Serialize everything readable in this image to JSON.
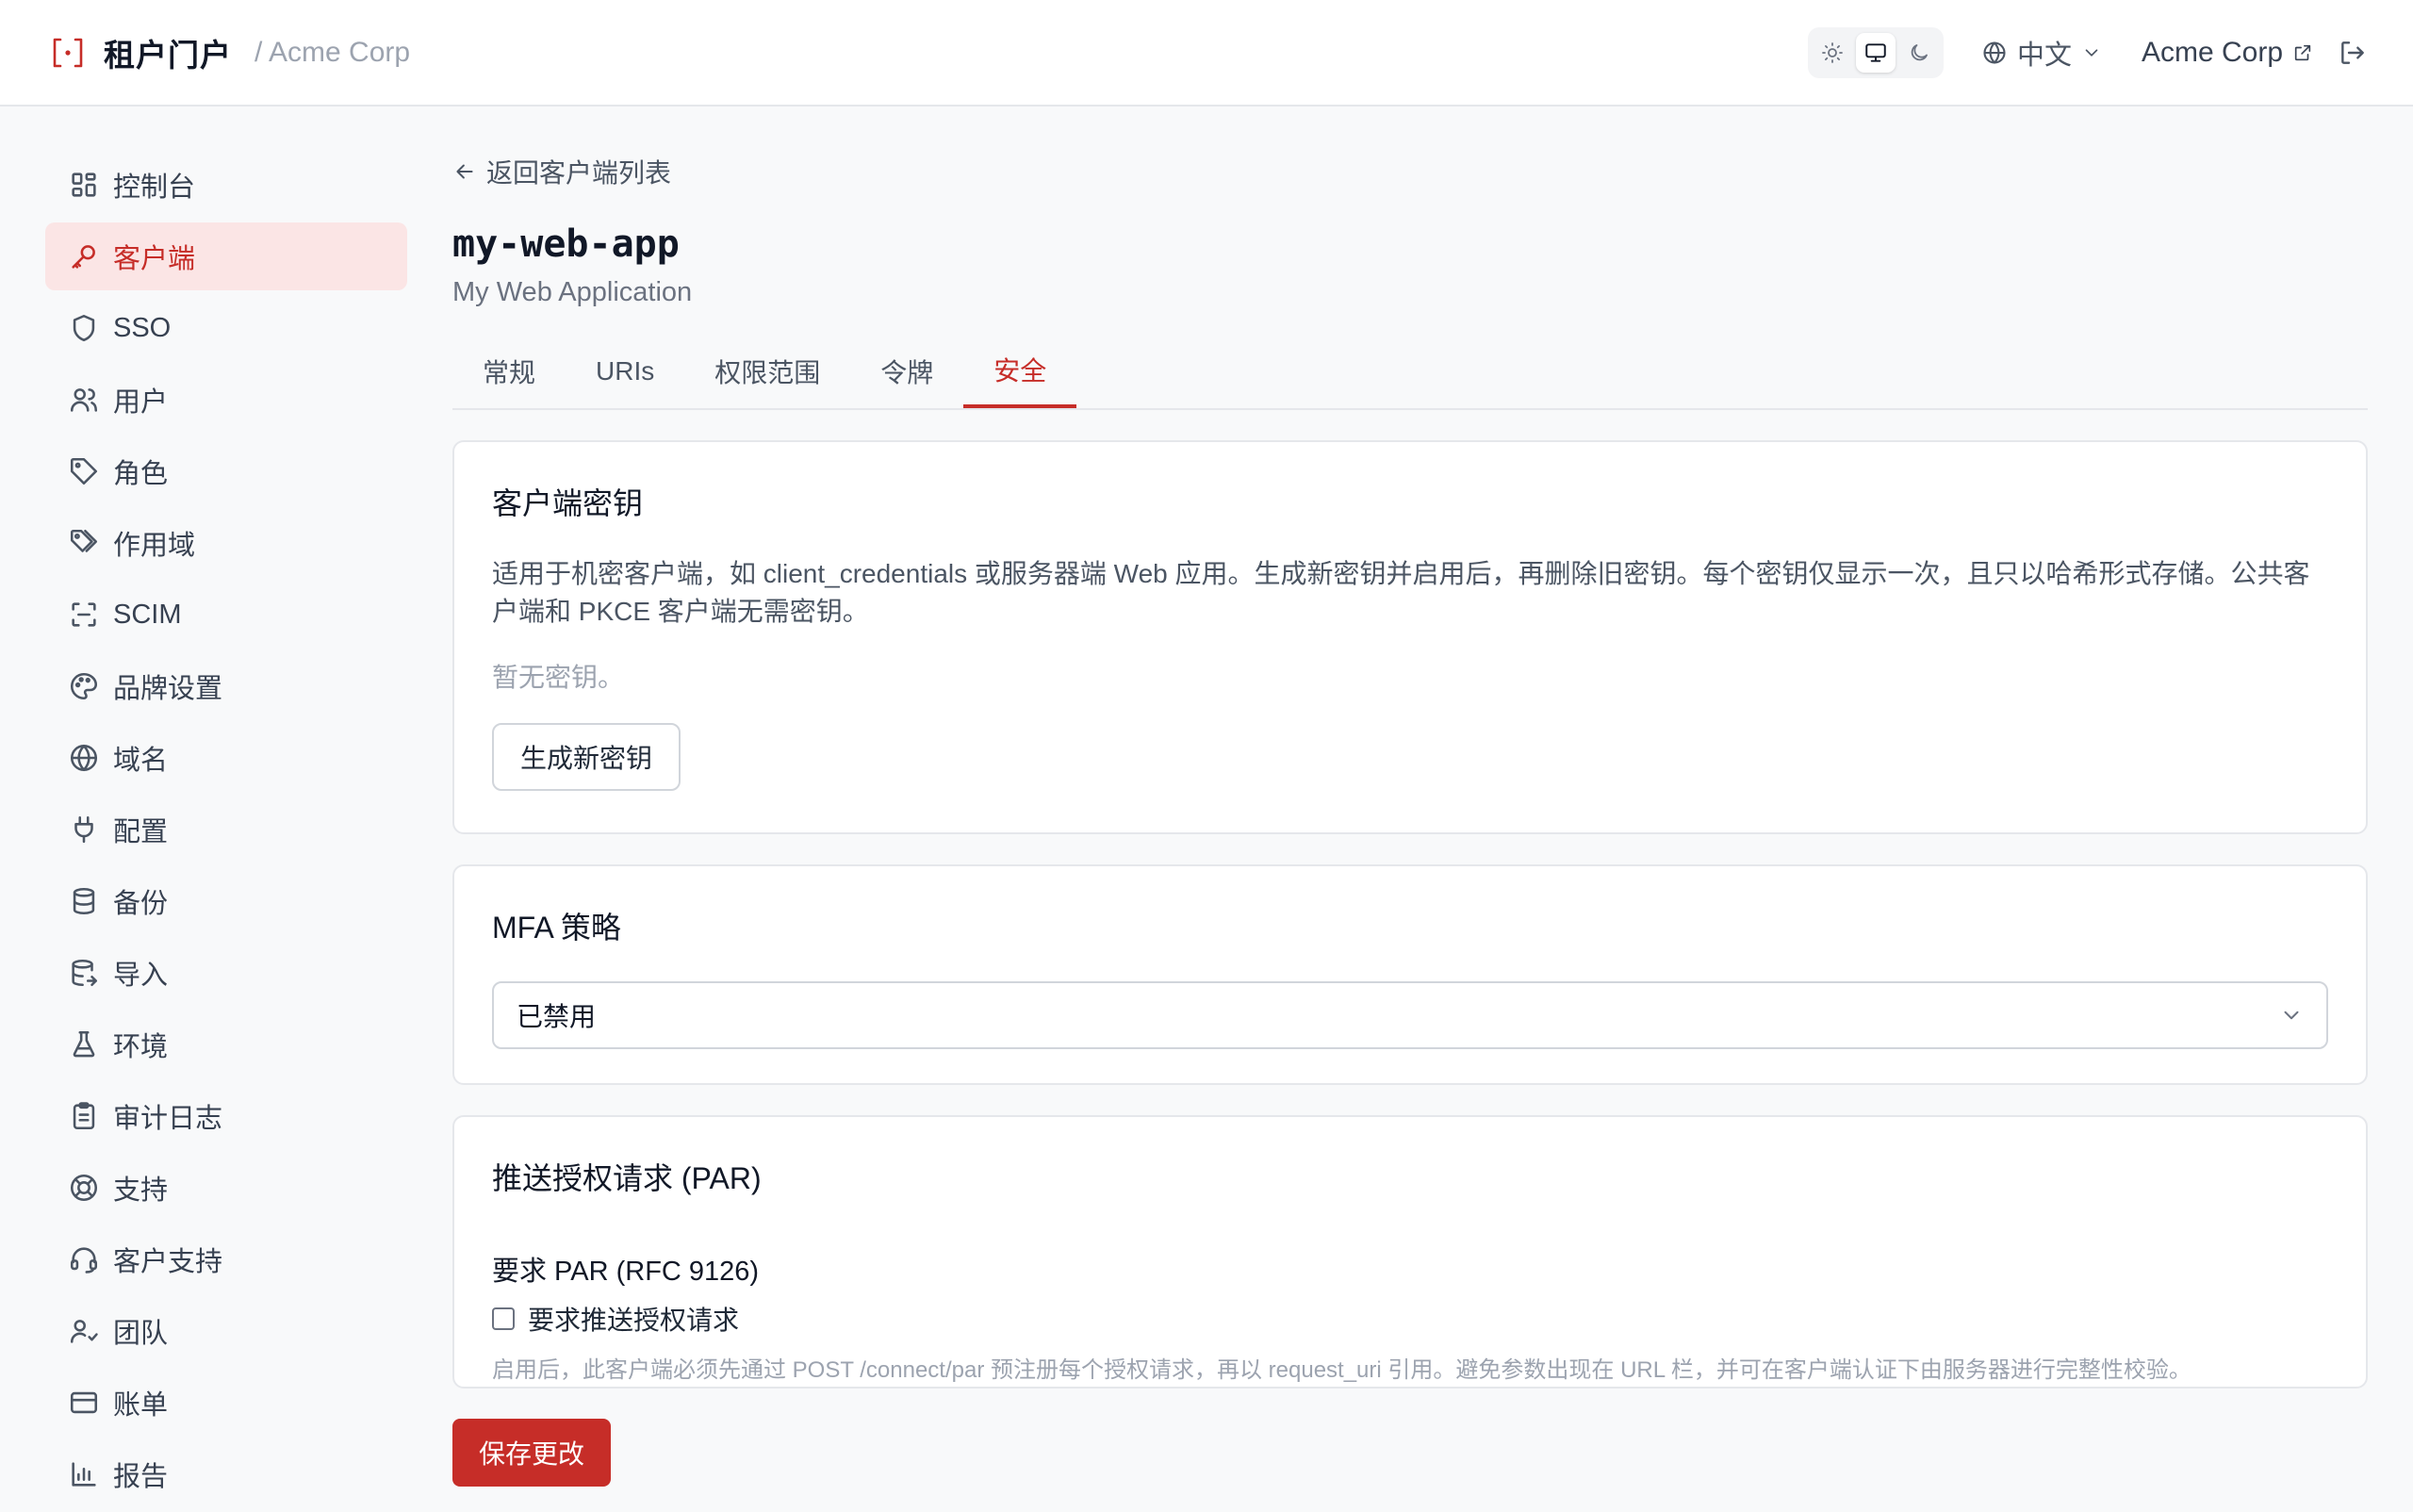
{
  "header": {
    "brand": "租户门户",
    "tenant": "/ Acme Corp",
    "language": "中文",
    "org": "Acme Corp"
  },
  "sidebar": {
    "items": [
      {
        "label": "控制台",
        "icon": "dashboard-icon"
      },
      {
        "label": "客户端",
        "icon": "key-icon",
        "active": true
      },
      {
        "label": "SSO",
        "icon": "shield-icon"
      },
      {
        "label": "用户",
        "icon": "users-icon"
      },
      {
        "label": "角色",
        "icon": "tag-icon"
      },
      {
        "label": "作用域",
        "icon": "tags-icon"
      },
      {
        "label": "SCIM",
        "icon": "scan-icon"
      },
      {
        "label": "品牌设置",
        "icon": "palette-icon"
      },
      {
        "label": "域名",
        "icon": "globe-icon"
      },
      {
        "label": "配置",
        "icon": "plug-icon"
      },
      {
        "label": "备份",
        "icon": "database-icon"
      },
      {
        "label": "导入",
        "icon": "database-import-icon"
      },
      {
        "label": "环境",
        "icon": "flask-icon"
      },
      {
        "label": "审计日志",
        "icon": "clipboard-icon"
      },
      {
        "label": "支持",
        "icon": "lifebuoy-icon"
      },
      {
        "label": "客户支持",
        "icon": "headset-icon"
      },
      {
        "label": "团队",
        "icon": "team-icon"
      },
      {
        "label": "账单",
        "icon": "credit-card-icon"
      },
      {
        "label": "报告",
        "icon": "bar-chart-icon"
      }
    ]
  },
  "main": {
    "back_label": "返回客户端列表",
    "title": "my-web-app",
    "subtitle": "My Web Application",
    "tabs": [
      "常规",
      "URIs",
      "权限范围",
      "令牌",
      "安全"
    ],
    "active_tab": "安全",
    "secrets": {
      "title": "客户端密钥",
      "description": "适用于机密客户端，如 client_credentials 或服务器端 Web 应用。生成新密钥并启用后，再删除旧密钥。每个密钥仅显示一次，且只以哈希形式存储。公共客户端和 PKCE 客户端无需密钥。",
      "empty": "暂无密钥。",
      "generate_label": "生成新密钥"
    },
    "mfa": {
      "title": "MFA 策略",
      "selected": "已禁用"
    },
    "par": {
      "title": "推送授权请求 (PAR)",
      "field_label": "要求 PAR (RFC 9126)",
      "checkbox_label": "要求推送授权请求",
      "checked": false,
      "help": "启用后，此客户端必须先通过 POST /connect/par 预注册每个授权请求，再以 request_uri 引用。避免参数出现在 URL 栏，并可在客户端认证下由服务器进行完整性校验。"
    },
    "save_label": "保存更改"
  },
  "colors": {
    "accent": "#c62d28",
    "active_nav_bg": "#fbe5e5"
  }
}
